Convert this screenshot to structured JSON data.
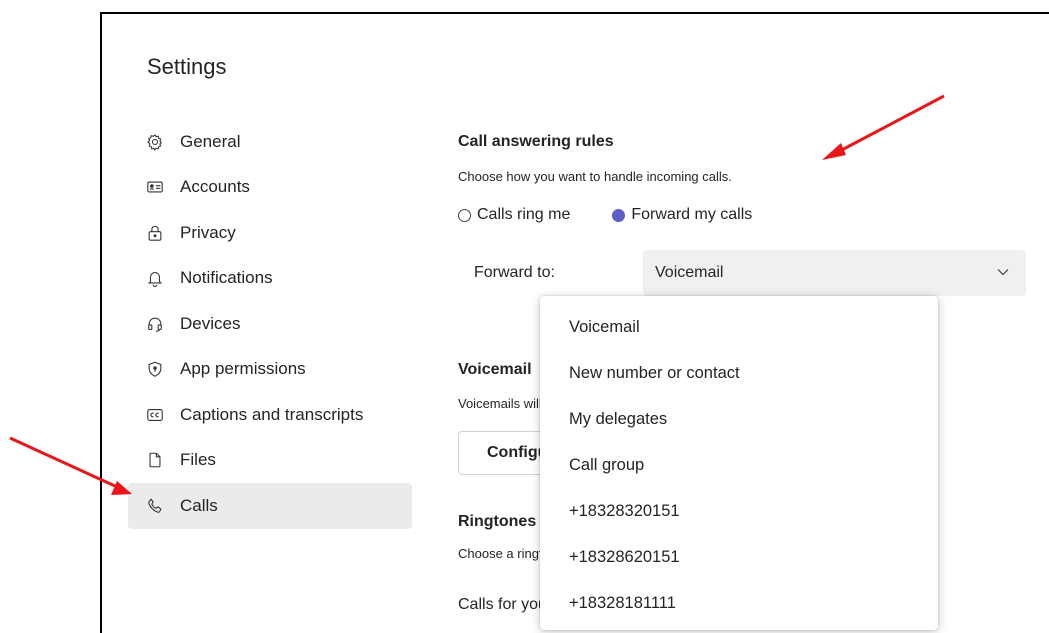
{
  "settings": {
    "title": "Settings"
  },
  "nav": {
    "items": [
      {
        "label": "General",
        "icon": "gear-icon"
      },
      {
        "label": "Accounts",
        "icon": "id-card-icon"
      },
      {
        "label": "Privacy",
        "icon": "lock-icon"
      },
      {
        "label": "Notifications",
        "icon": "bell-icon"
      },
      {
        "label": "Devices",
        "icon": "headset-icon"
      },
      {
        "label": "App permissions",
        "icon": "shield-icon"
      },
      {
        "label": "Captions and transcripts",
        "icon": "captions-icon"
      },
      {
        "label": "Files",
        "icon": "file-icon"
      },
      {
        "label": "Calls",
        "icon": "phone-icon",
        "active": true
      }
    ]
  },
  "call_answering": {
    "title": "Call answering rules",
    "description": "Choose how you want to handle incoming calls.",
    "options": [
      {
        "label": "Calls ring me",
        "selected": false
      },
      {
        "label": "Forward my calls",
        "selected": true
      }
    ],
    "forward_to_label": "Forward to:",
    "forward_to_value": "Voicemail"
  },
  "voicemail": {
    "title": "Voicemail",
    "description": "Voicemails will show in th",
    "configure_button": "Configure voicem"
  },
  "ringtones": {
    "title": "Ringtones",
    "description": "Choose a ringtone for inc",
    "calls_for_you_label": "Calls for you"
  },
  "dropdown": {
    "options": [
      "Voicemail",
      "New number or contact",
      "My delegates",
      "Call group",
      "+18328320151",
      "+18328620151",
      "+18328181111"
    ]
  },
  "colors": {
    "accent": "#5b5fc7",
    "annotation_arrow": "#e8161b",
    "active_nav_bg": "#ebebeb"
  }
}
